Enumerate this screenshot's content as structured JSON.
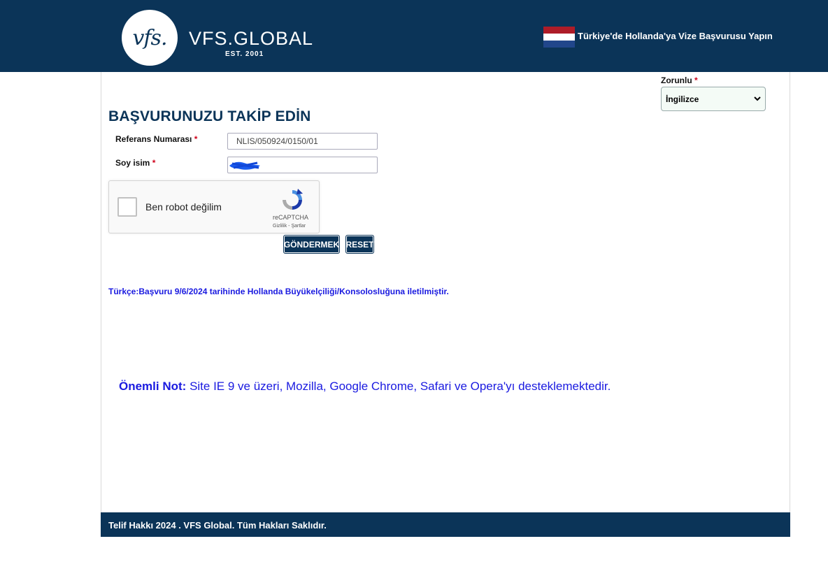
{
  "header": {
    "logo_mark": "vfs.",
    "logo_text": "VFS.GLOBAL",
    "logo_est": "EST. 2001",
    "tagline": "Türkiye'de Hollanda'ya Vize Başvurusu Yapın",
    "flag_colors": [
      "#ae1c28",
      "#ffffff",
      "#21468b"
    ],
    "bg_color": "#0b3458"
  },
  "language": {
    "label": "Zorunlu",
    "required_mark": "*",
    "selected": "İngilizce"
  },
  "form": {
    "title": "BAŞVURUNUZU TAKİP EDİN",
    "reference_label": "Referans Numarası",
    "reference_required": "*",
    "reference_value": "NLIS/050924/0150/01",
    "surname_label": "Soy isim",
    "surname_required": "*",
    "surname_value": "",
    "captcha_label": "Ben robot değilim",
    "captcha_brand": "reCAPTCHA",
    "captcha_links": "Gizlilik - Şartlar",
    "submit_label": "GÖNDERMEK",
    "reset_label": "RESET"
  },
  "status_message": "Türkçe:Başvuru 9/6/2024 tarihinde Hollanda Büyükelçiliği/Konsolosluğuna iletilmiştir.",
  "note": {
    "prefix": "Önemli Not:",
    "text": " Site IE 9 ve üzeri, Mozilla, Google Chrome, Safari ve Opera'yı desteklemektedir."
  },
  "footer": {
    "text": "Telif Hakkı 2024 . VFS Global. Tüm Hakları Saklıdır."
  }
}
